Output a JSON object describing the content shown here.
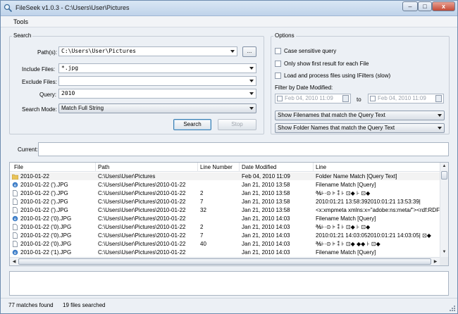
{
  "window": {
    "title": "FileSeek v1.0.3  -  C:\\Users\\User\\Pictures",
    "controls": {
      "minimize": "–",
      "maximize": "□",
      "close": "x"
    }
  },
  "menu": {
    "tools": "Tools"
  },
  "search": {
    "group_label": "Search",
    "paths_label": "Path(s):",
    "paths_value": "C:\\Users\\User\\Pictures",
    "browse_label": "...",
    "include_label": "Include Files:",
    "include_value": "*.jpg",
    "exclude_label": "Exclude Files:",
    "exclude_value": "",
    "query_label": "Query:",
    "query_value": "2010",
    "mode_label": "Search Mode:",
    "mode_value": "Match Full String",
    "search_button": "Search",
    "stop_button": "Stop"
  },
  "options": {
    "group_label": "Options",
    "case_sensitive": "Case sensitive query",
    "first_result": "Only show first result for each File",
    "load_process": "Load and process files using IFilters (slow)",
    "filter_date_label": "Filter by Date Modified:",
    "date_from": "Feb 04, 2010 11:09",
    "date_to_label": "to",
    "date_to": "Feb 04, 2010 11:09",
    "filenames_select": "Show Filenames that match the Query Text",
    "folders_select": "Show Folder Names that match the Query Text"
  },
  "current": {
    "label": "Current:",
    "value": ""
  },
  "results": {
    "columns": [
      "File",
      "Path",
      "Line Number",
      "Date Modified",
      "Line"
    ],
    "rows": [
      {
        "icon": "folder",
        "file": "2010-01-22",
        "path": "C:\\Users\\User\\Pictures",
        "line_number": "",
        "date": "Feb 04, 2010 11:09",
        "line": "Folder Name Match [Query Text]"
      },
      {
        "icon": "ie",
        "file": "2010-01-22 (').JPG",
        "path": "C:\\Users\\User\\Pictures\\2010-01-22",
        "line_number": "",
        "date": "Jan 21, 2010 13:58",
        "line": "Filename Match [Query]"
      },
      {
        "icon": "doc",
        "file": "2010-01-22 (').JPG",
        "path": "C:\\Users\\User\\Pictures\\2010-01-22",
        "line_number": "2",
        "date": "Jan 21, 2010 13:58",
        "line": "    ℁⊦·⊙    ⊧ ⁑   ⊦   ⊡◆   ⊦    ⊡◆"
      },
      {
        "icon": "doc",
        "file": "2010-01-22 (').JPG",
        "path": "C:\\Users\\User\\Pictures\\2010-01-22",
        "line_number": "7",
        "date": "Jan 21, 2010 13:58",
        "line": "2010:01:21 13:58:392010:01:21 13:53:39|"
      },
      {
        "icon": "doc",
        "file": "2010-01-22 (').JPG",
        "path": "C:\\Users\\User\\Pictures\\2010-01-22",
        "line_number": "32",
        "date": "Jan 21, 2010 13:58",
        "line": "<x:xmpmeta xmlns:x=\"adobe:ns:meta/\"><rdf:RDF xm"
      },
      {
        "icon": "ie",
        "file": "2010-01-22 ('0).JPG",
        "path": "C:\\Users\\User\\Pictures\\2010-01-22",
        "line_number": "",
        "date": "Jan 21, 2010 14:03",
        "line": "Filename Match [Query]"
      },
      {
        "icon": "doc",
        "file": "2010-01-22 ('0).JPG",
        "path": "C:\\Users\\User\\Pictures\\2010-01-22",
        "line_number": "2",
        "date": "Jan 21, 2010 14:03",
        "line": "    ℁⊦·⊙    ⊧ ⁑   ⊦   ⊡◆   ⊦    ⊡◆"
      },
      {
        "icon": "doc",
        "file": "2010-01-22 ('0).JPG",
        "path": "C:\\Users\\User\\Pictures\\2010-01-22",
        "line_number": "7",
        "date": "Jan 21, 2010 14:03",
        "line": "2010:01:21 14:03:052010:01:21 14:03:05|   ⊡◆"
      },
      {
        "icon": "doc",
        "file": "2010-01-22 ('0).JPG",
        "path": "C:\\Users\\User\\Pictures\\2010-01-22",
        "line_number": "40",
        "date": "Jan 21, 2010 14:03",
        "line": "    ℁⊦·⊙    ⊧ ⁑   ⊦   ⊡◆   ◆◆ ⊦  ⊡◆"
      },
      {
        "icon": "ie",
        "file": "2010-01-22 ('1).JPG",
        "path": "C:\\Users\\User\\Pictures\\2010-01-22",
        "line_number": "",
        "date": "Jan 21, 2010 14:03",
        "line": "Filename Match [Query]"
      }
    ]
  },
  "status": {
    "matches": "77 matches found",
    "files": "19 files searched"
  },
  "colors": {
    "title_bar": "#c9dbef",
    "close_button": "#c44a36",
    "window_bg": "#ecf0f5"
  }
}
